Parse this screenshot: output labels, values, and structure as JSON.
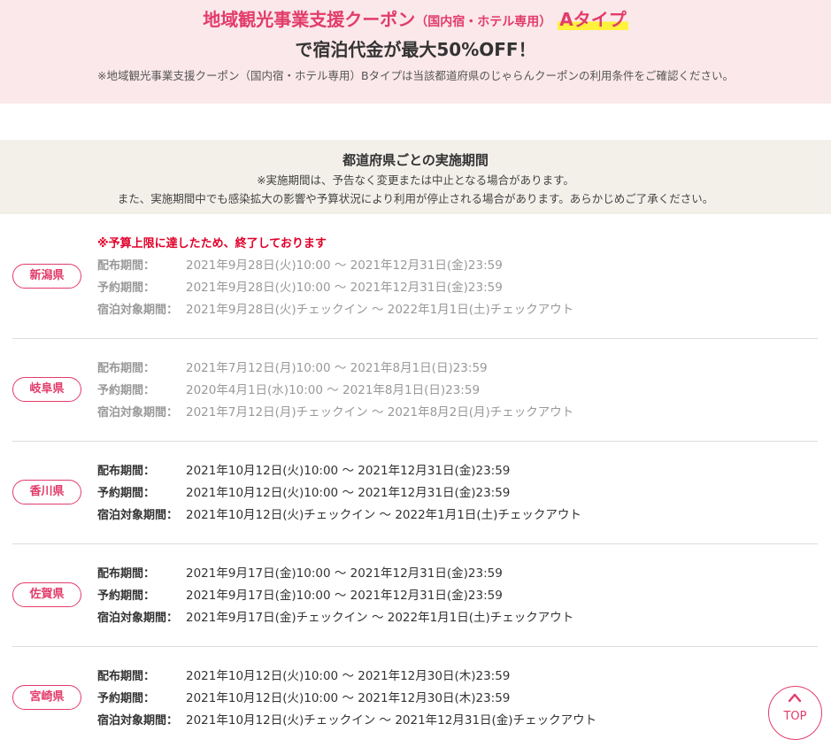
{
  "hero": {
    "title_main": "地域観光事業支援クーポン",
    "title_paren": "（国内宿・ホテル専用）",
    "title_type": "Aタイプ",
    "title_line2": "で宿泊代金が最大50%OFF！",
    "note": "※地域観光事業支援クーポン（国内宿・ホテル専用）Bタイプは当該都道府県のじゃらんクーポンの利用条件をご確認ください。"
  },
  "period_section": {
    "title": "都道府県ごとの実施期間",
    "note1": "※実施期間は、予告なく変更または中止となる場合があります。",
    "note2": "また、実施期間中でも感染拡大の影響や予算状況により利用が停止される場合があります。あらかじめご了承ください。"
  },
  "labels": {
    "distribution": "配布期間：",
    "reservation": "予約期間：",
    "stay": "宿泊対象期間："
  },
  "prefectures": [
    {
      "name": "新潟県",
      "ended_note": "※予算上限に達したため、終了しております",
      "distribution": "2021年9月28日(火)10:00 〜 2021年12月31日(金)23:59",
      "reservation": "2021年9月28日(火)10:00 〜 2021年12月31日(金)23:59",
      "stay": "2021年9月28日(火)チェックイン 〜 2022年1月1日(土)チェックアウト"
    },
    {
      "name": "岐阜県",
      "distribution": "2021年7月12日(月)10:00 〜 2021年8月1日(日)23:59",
      "reservation": "2020年4月1日(水)10:00 〜 2021年8月1日(日)23:59",
      "stay": "2021年7月12日(月)チェックイン 〜 2021年8月2日(月)チェックアウト"
    },
    {
      "name": "香川県",
      "distribution": "2021年10月12日(火)10:00 〜 2021年12月31日(金)23:59",
      "reservation": "2021年10月12日(火)10:00 〜 2021年12月31日(金)23:59",
      "stay": "2021年10月12日(火)チェックイン 〜 2022年1月1日(土)チェックアウト"
    },
    {
      "name": "佐賀県",
      "distribution": "2021年9月17日(金)10:00 〜 2021年12月31日(金)23:59",
      "reservation": "2021年9月17日(金)10:00 〜 2021年12月31日(金)23:59",
      "stay": "2021年9月17日(金)チェックイン 〜 2022年1月1日(土)チェックアウト"
    },
    {
      "name": "宮崎県",
      "distribution": "2021年10月12日(火)10:00 〜 2021年12月30日(木)23:59",
      "reservation": "2021年10月12日(火)10:00 〜 2021年12月30日(木)23:59",
      "stay": "2021年10月12日(火)チェックイン 〜 2021年12月31日(金)チェックアウト"
    }
  ],
  "top_button": {
    "arrow_icon": "chevron-up-icon",
    "label": "TOP"
  },
  "colors": {
    "accent": "#e23c6a",
    "hero_bg": "#fbe8ea",
    "section_bg": "#f3f0ea",
    "highlight": "#fff23c",
    "ended_red": "#e0002a",
    "grey_text": "#999999"
  }
}
